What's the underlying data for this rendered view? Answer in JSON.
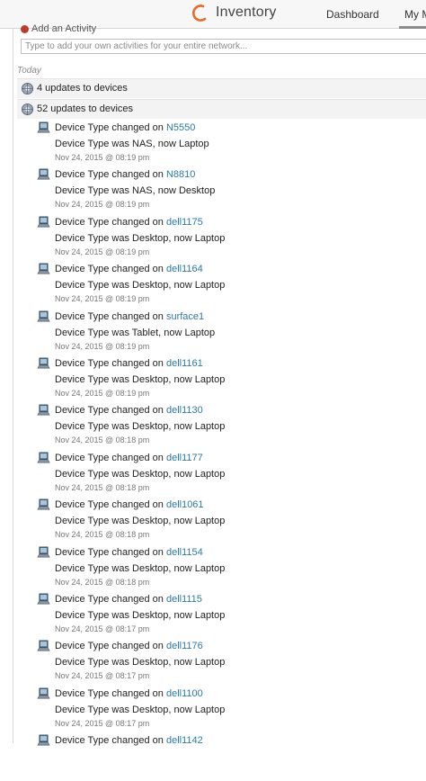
{
  "header": {
    "app_title": "Inventory",
    "nav": {
      "dashboard": "Dashboard",
      "my": "My M"
    }
  },
  "composer": {
    "add_label": "Add an Activity",
    "placeholder": "Type to add your own activities for your entire network..."
  },
  "feed": {
    "day_label": "Today",
    "groups": [
      {
        "label": "4 updates to devices"
      },
      {
        "label": "52 updates to devices"
      }
    ],
    "change_prefix": "Device Type changed on",
    "entries": [
      {
        "device": "N5550",
        "detail": "Device Type was NAS, now Laptop",
        "time": "Nov 24, 2015 @ 08:19 pm"
      },
      {
        "device": "N8810",
        "detail": "Device Type was NAS, now Desktop",
        "time": "Nov 24, 2015 @ 08:19 pm"
      },
      {
        "device": "dell1175",
        "detail": "Device Type was Desktop, now Laptop",
        "time": "Nov 24, 2015 @ 08:19 pm"
      },
      {
        "device": "dell1164",
        "detail": "Device Type was Desktop, now Laptop",
        "time": "Nov 24, 2015 @ 08:19 pm"
      },
      {
        "device": "surface1",
        "detail": "Device Type was Tablet, now Laptop",
        "time": "Nov 24, 2015 @ 08:19 pm"
      },
      {
        "device": "dell1161",
        "detail": "Device Type was Desktop, now Laptop",
        "time": "Nov 24, 2015 @ 08:19 pm"
      },
      {
        "device": "dell1130",
        "detail": "Device Type was Desktop, now Laptop",
        "time": "Nov 24, 2015 @ 08:18 pm"
      },
      {
        "device": "dell1177",
        "detail": "Device Type was Desktop, now Laptop",
        "time": "Nov 24, 2015 @ 08:18 pm"
      },
      {
        "device": "dell1061",
        "detail": "Device Type was Desktop, now Laptop",
        "time": "Nov 24, 2015 @ 08:18 pm"
      },
      {
        "device": "dell1154",
        "detail": "Device Type was Desktop, now Laptop",
        "time": "Nov 24, 2015 @ 08:18 pm"
      },
      {
        "device": "dell1115",
        "detail": "Device Type was Desktop, now Laptop",
        "time": "Nov 24, 2015 @ 08:17 pm"
      },
      {
        "device": "dell1176",
        "detail": "Device Type was Desktop, now Laptop",
        "time": "Nov 24, 2015 @ 08:17 pm"
      },
      {
        "device": "dell1100",
        "detail": "Device Type was Desktop, now Laptop",
        "time": "Nov 24, 2015 @ 08:17 pm"
      },
      {
        "device": "dell1142",
        "detail": "",
        "time": ""
      }
    ]
  },
  "colors": {
    "accent": "#2a7aa8",
    "logo": "#e8692a"
  }
}
